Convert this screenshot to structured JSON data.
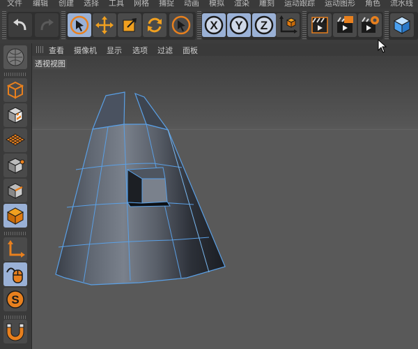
{
  "menubar": {
    "items": [
      "文件",
      "编辑",
      "创建",
      "选择",
      "工具",
      "网格",
      "捕捉",
      "动画",
      "模拟",
      "渲染",
      "雕刻",
      "运动跟踪",
      "运动图形",
      "角色",
      "流水线"
    ]
  },
  "toolbar": {
    "tools": [
      {
        "name": "undo",
        "icon": "undo-icon"
      },
      {
        "name": "redo",
        "icon": "redo-icon"
      },
      {
        "name": "live-selection",
        "icon": "selection-arrow-icon"
      },
      {
        "name": "move",
        "icon": "move-icon"
      },
      {
        "name": "scale",
        "icon": "scale-icon"
      },
      {
        "name": "rotate",
        "icon": "rotate-icon"
      },
      {
        "name": "recent-tool",
        "icon": "selection-arrow-icon"
      },
      {
        "name": "x-axis",
        "icon": "x-axis-icon",
        "label": "X"
      },
      {
        "name": "y-axis",
        "icon": "y-axis-icon",
        "label": "Y"
      },
      {
        "name": "z-axis",
        "icon": "z-axis-icon",
        "label": "Z"
      },
      {
        "name": "coordinate-system",
        "icon": "coordinate-system-icon"
      },
      {
        "name": "render-view",
        "icon": "clapboard-icon"
      },
      {
        "name": "render-to-picture-viewer",
        "icon": "clapboard-icon"
      },
      {
        "name": "render-settings",
        "icon": "clapboard-gear-icon"
      },
      {
        "name": "cube",
        "icon": "cube-icon"
      }
    ]
  },
  "viewport_menu": {
    "items": [
      "查看",
      "摄像机",
      "显示",
      "选项",
      "过滤",
      "面板"
    ]
  },
  "viewport": {
    "label": "透视视图"
  },
  "colors": {
    "accent_blue": "#9ab1d6",
    "orange": "#e8801e",
    "wire": "#5aa0e6",
    "background": "#595959"
  }
}
